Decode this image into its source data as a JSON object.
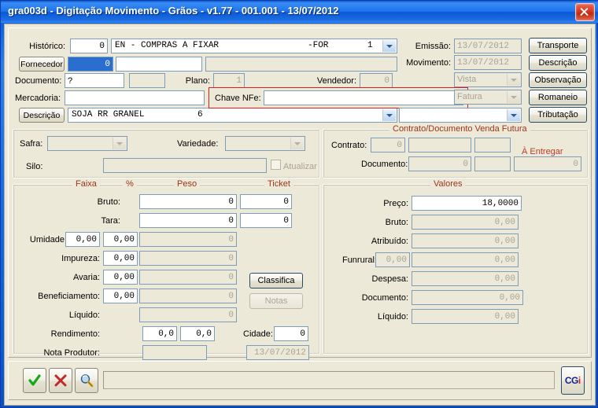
{
  "window": {
    "title": "gra003d - Digitação Movimento - Grãos - v1.77 - 001.001 - 13/07/2012",
    "close_label": "Fechar"
  },
  "header": {
    "historico_label": "Histórico:",
    "historico_value": "0",
    "historico_desc": "EN - COMPRAS A FIXAR",
    "historico_desc_suffix": "-FOR",
    "historico_desc_num": "1",
    "fornecedor_button": "Fornecedor",
    "fornecedor_code": "0",
    "fornecedor_name": "",
    "fornecedor_extra": "",
    "documento_label": "Documento:",
    "documento_value": "?",
    "documento_extra": "",
    "plano_label": "Plano:",
    "plano_value": "1",
    "vendedor_label": "Vendedor:",
    "vendedor_value": "0",
    "mercadoria_label": "Mercadoria:",
    "mercadoria_value": "",
    "chave_nfe_label": "Chave NFe:",
    "chave_nfe_value": "",
    "descricao_button": "Descrição",
    "descricao_value": "SOJA RR GRANEL",
    "descricao_num": "6",
    "emissao_label": "Emissão:",
    "emissao_value": "13/07/2012",
    "movimento_label": "Movimento:",
    "movimento_value": "13/07/2012",
    "pagamento_value": "Vista",
    "fatura_value": "Fatura",
    "extra_combo_value": ""
  },
  "side_buttons": [
    {
      "label": "Transporte"
    },
    {
      "label": "Descrição"
    },
    {
      "label": "Observação"
    },
    {
      "label": "Romaneio"
    },
    {
      "label": "Tributação"
    }
  ],
  "safra_group": {
    "safra_label": "Safra:",
    "safra_value": "",
    "variedade_label": "Variedade:",
    "variedade_value": "",
    "silo_label": "Silo:",
    "silo_value": "",
    "atualizar_label": "Atualizar",
    "atualizar_checked": false
  },
  "contrato_group": {
    "caption": "Contrato/Documento Venda Futura",
    "contrato_label": "Contrato:",
    "contrato_value": "0",
    "contrato_desc": "",
    "contrato_extra": "",
    "entregar_label": "À Entregar",
    "entregar_value": "0",
    "documento_label": "Documento:",
    "documento_value": "0",
    "documento_extra": ""
  },
  "pesos_group": {
    "headers": {
      "faixa": "Faixa",
      "percent": "%",
      "peso": "Peso",
      "ticket": "Ticket"
    },
    "rows": [
      {
        "label": "Bruto:",
        "faixa": null,
        "pct": null,
        "peso": "0",
        "ticket": "0",
        "peso_ro": false,
        "ticket_ro": false
      },
      {
        "label": "Tara:",
        "faixa": null,
        "pct": null,
        "peso": "0",
        "ticket": "0",
        "peso_ro": false,
        "ticket_ro": false
      },
      {
        "label": "Umidade:",
        "faixa": "0,00",
        "pct": "0,00",
        "peso": "0",
        "ticket": null,
        "peso_ro": true
      },
      {
        "label": "Impureza:",
        "faixa": null,
        "pct": "0,00",
        "peso": "0",
        "ticket": null,
        "peso_ro": true
      },
      {
        "label": "Avaria:",
        "faixa": null,
        "pct": "0,00",
        "peso": "0",
        "ticket": null,
        "peso_ro": true
      },
      {
        "label": "Beneficiamento:",
        "faixa": null,
        "pct": "0,00",
        "peso": "0",
        "ticket": null,
        "peso_ro": true
      },
      {
        "label": "Líquido:",
        "faixa": null,
        "pct": null,
        "peso": "0",
        "ticket": null,
        "peso_ro": true
      }
    ],
    "rendimento_label": "Rendimento:",
    "rendimento_1": "0,0",
    "rendimento_2": "0,0",
    "cidade_label": "Cidade:",
    "cidade_value": "0",
    "nota_produtor_label": "Nota Produtor:",
    "nota_produtor_value": "",
    "nota_produtor_date": "13/07/2012",
    "classifica_button": "Classifica",
    "notas_button": "Notas"
  },
  "valores_group": {
    "caption": "Valores",
    "rows": [
      {
        "label": "Preço:",
        "extra": null,
        "value": "18,0000",
        "readonly": false
      },
      {
        "label": "Bruto:",
        "extra": null,
        "value": "0,00",
        "readonly": true
      },
      {
        "label": "Atribuído:",
        "extra": null,
        "value": "0,00",
        "readonly": true
      },
      {
        "label": "Funrural:",
        "extra": "0,00",
        "value": "0,00",
        "readonly": true
      },
      {
        "label": "Despesa:",
        "extra": null,
        "value": "0,00",
        "readonly": true
      },
      {
        "label": "Documento:",
        "extra": null,
        "value": "0,00",
        "readonly": true
      },
      {
        "label": "Líquido:",
        "extra": null,
        "value": "0,00",
        "readonly": true
      }
    ]
  },
  "toolbar": {
    "confirm_icon": "check-icon",
    "cancel_icon": "cross-icon",
    "search_icon": "magnifier-icon",
    "status_value": "",
    "logo_text_1": "CG",
    "logo_text_2": "i"
  }
}
